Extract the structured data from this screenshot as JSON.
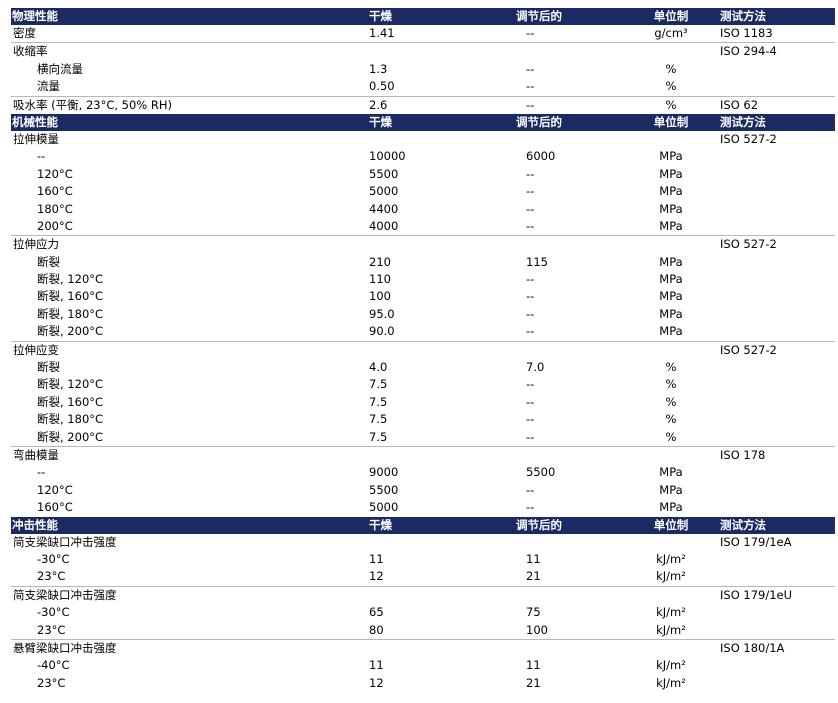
{
  "sections": [
    {
      "header": {
        "name": "物理性能",
        "dry": "干燥",
        "cond": "调节后的",
        "unit": "单位制",
        "method": "测试方法"
      },
      "rows": [
        {
          "name": "密度",
          "dry": "1.41",
          "cond": "--",
          "unit": "g/cm³",
          "method": "ISO 1183",
          "indent": false,
          "sep": false
        },
        {
          "name": "收缩率",
          "dry": "",
          "cond": "",
          "unit": "",
          "method": "ISO 294-4",
          "indent": false,
          "sep": true
        },
        {
          "name": "横向流量",
          "dry": "1.3",
          "cond": "--",
          "unit": "%",
          "method": "",
          "indent": true,
          "sep": false
        },
        {
          "name": "流量",
          "dry": "0.50",
          "cond": "--",
          "unit": "%",
          "method": "",
          "indent": true,
          "sep": false
        },
        {
          "name": "吸水率 (平衡, 23°C, 50% RH)",
          "dry": "2.6",
          "cond": "--",
          "unit": "%",
          "method": "ISO 62",
          "indent": false,
          "sep": true
        }
      ]
    },
    {
      "header": {
        "name": "机械性能",
        "dry": "干燥",
        "cond": "调节后的",
        "unit": "单位制",
        "method": "测试方法"
      },
      "rows": [
        {
          "name": "拉伸模量",
          "dry": "",
          "cond": "",
          "unit": "",
          "method": "ISO 527-2",
          "indent": false,
          "sep": false
        },
        {
          "name": "--",
          "dry": "10000",
          "cond": "6000",
          "unit": "MPa",
          "method": "",
          "indent": true,
          "sep": false
        },
        {
          "name": "120°C",
          "dry": "5500",
          "cond": "--",
          "unit": "MPa",
          "method": "",
          "indent": true,
          "sep": false
        },
        {
          "name": "160°C",
          "dry": "5000",
          "cond": "--",
          "unit": "MPa",
          "method": "",
          "indent": true,
          "sep": false
        },
        {
          "name": "180°C",
          "dry": "4400",
          "cond": "--",
          "unit": "MPa",
          "method": "",
          "indent": true,
          "sep": false
        },
        {
          "name": "200°C",
          "dry": "4000",
          "cond": "--",
          "unit": "MPa",
          "method": "",
          "indent": true,
          "sep": false
        },
        {
          "name": "拉伸应力",
          "dry": "",
          "cond": "",
          "unit": "",
          "method": "ISO 527-2",
          "indent": false,
          "sep": true
        },
        {
          "name": "断裂",
          "dry": "210",
          "cond": "115",
          "unit": "MPa",
          "method": "",
          "indent": true,
          "sep": false
        },
        {
          "name": "断裂, 120°C",
          "dry": "110",
          "cond": "--",
          "unit": "MPa",
          "method": "",
          "indent": true,
          "sep": false
        },
        {
          "name": "断裂, 160°C",
          "dry": "100",
          "cond": "--",
          "unit": "MPa",
          "method": "",
          "indent": true,
          "sep": false
        },
        {
          "name": "断裂, 180°C",
          "dry": "95.0",
          "cond": "--",
          "unit": "MPa",
          "method": "",
          "indent": true,
          "sep": false
        },
        {
          "name": "断裂, 200°C",
          "dry": "90.0",
          "cond": "--",
          "unit": "MPa",
          "method": "",
          "indent": true,
          "sep": false
        },
        {
          "name": "拉伸应变",
          "dry": "",
          "cond": "",
          "unit": "",
          "method": "ISO 527-2",
          "indent": false,
          "sep": true
        },
        {
          "name": "断裂",
          "dry": "4.0",
          "cond": "7.0",
          "unit": "%",
          "method": "",
          "indent": true,
          "sep": false
        },
        {
          "name": "断裂, 120°C",
          "dry": "7.5",
          "cond": "--",
          "unit": "%",
          "method": "",
          "indent": true,
          "sep": false
        },
        {
          "name": "断裂, 160°C",
          "dry": "7.5",
          "cond": "--",
          "unit": "%",
          "method": "",
          "indent": true,
          "sep": false
        },
        {
          "name": "断裂, 180°C",
          "dry": "7.5",
          "cond": "--",
          "unit": "%",
          "method": "",
          "indent": true,
          "sep": false
        },
        {
          "name": "断裂, 200°C",
          "dry": "7.5",
          "cond": "--",
          "unit": "%",
          "method": "",
          "indent": true,
          "sep": false
        },
        {
          "name": "弯曲模量",
          "dry": "",
          "cond": "",
          "unit": "",
          "method": "ISO 178",
          "indent": false,
          "sep": true
        },
        {
          "name": "--",
          "dry": "9000",
          "cond": "5500",
          "unit": "MPa",
          "method": "",
          "indent": true,
          "sep": false
        },
        {
          "name": "120°C",
          "dry": "5500",
          "cond": "--",
          "unit": "MPa",
          "method": "",
          "indent": true,
          "sep": false
        },
        {
          "name": "160°C",
          "dry": "5000",
          "cond": "--",
          "unit": "MPa",
          "method": "",
          "indent": true,
          "sep": false
        }
      ]
    },
    {
      "header": {
        "name": "冲击性能",
        "dry": "干燥",
        "cond": "调节后的",
        "unit": "单位制",
        "method": "测试方法"
      },
      "rows": [
        {
          "name": "简支梁缺口冲击强度",
          "dry": "",
          "cond": "",
          "unit": "",
          "method": "ISO 179/1eA",
          "indent": false,
          "sep": false
        },
        {
          "name": "-30°C",
          "dry": "11",
          "cond": "11",
          "unit": "kJ/m²",
          "method": "",
          "indent": true,
          "sep": false
        },
        {
          "name": "23°C",
          "dry": "12",
          "cond": "21",
          "unit": "kJ/m²",
          "method": "",
          "indent": true,
          "sep": false
        },
        {
          "name": "简支梁缺口冲击强度",
          "dry": "",
          "cond": "",
          "unit": "",
          "method": "ISO 179/1eU",
          "indent": false,
          "sep": true
        },
        {
          "name": "-30°C",
          "dry": "65",
          "cond": "75",
          "unit": "kJ/m²",
          "method": "",
          "indent": true,
          "sep": false
        },
        {
          "name": "23°C",
          "dry": "80",
          "cond": "100",
          "unit": "kJ/m²",
          "method": "",
          "indent": true,
          "sep": false
        },
        {
          "name": "悬臂梁缺口冲击强度",
          "dry": "",
          "cond": "",
          "unit": "",
          "method": "ISO 180/1A",
          "indent": false,
          "sep": true
        },
        {
          "name": "-40°C",
          "dry": "11",
          "cond": "11",
          "unit": "kJ/m²",
          "method": "",
          "indent": true,
          "sep": false
        },
        {
          "name": "23°C",
          "dry": "12",
          "cond": "21",
          "unit": "kJ/m²",
          "method": "",
          "indent": true,
          "sep": false
        }
      ]
    }
  ]
}
